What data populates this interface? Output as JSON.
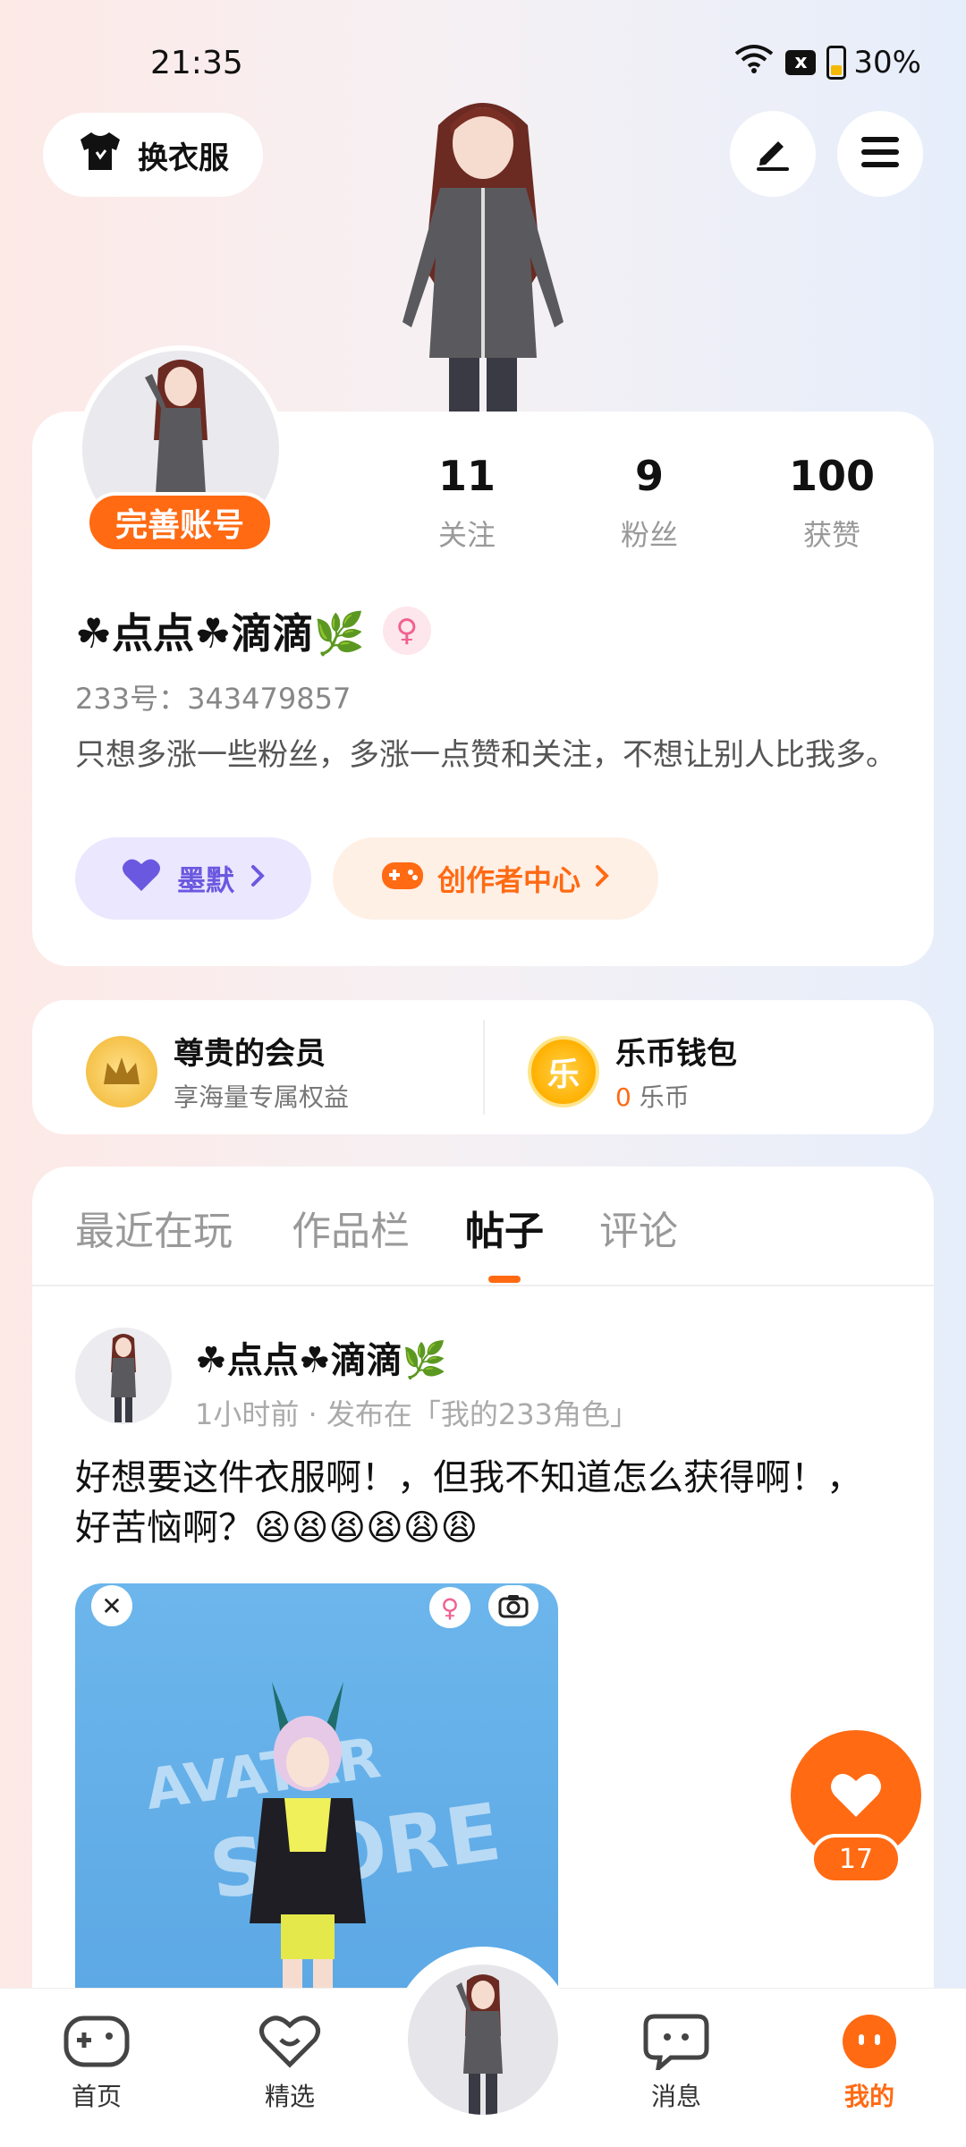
{
  "status_bar": {
    "time": "21:35",
    "battery": "30%",
    "sim_icon": "x"
  },
  "header": {
    "outfit_label": "换衣服"
  },
  "profile": {
    "complete_label": "完善账号",
    "stats": [
      {
        "value": "11",
        "label": "关注"
      },
      {
        "value": "9",
        "label": "粉丝"
      },
      {
        "value": "100",
        "label": "获赞"
      }
    ],
    "nickname": "☘点点☘滴滴🌿",
    "uid": "233号：343479857",
    "bio": "只想多涨一些粉丝，多涨一点赞和关注，不想让别人比我多。",
    "pill_mo": "墨默",
    "pill_creator": "创作者中心"
  },
  "vip": {
    "title": "尊贵的会员",
    "subtitle": "享海量专属权益"
  },
  "wallet": {
    "title": "乐币钱包",
    "coin_glyph": "乐",
    "amount": "0",
    "unit": "乐币"
  },
  "tabs": [
    {
      "label": "最近在玩"
    },
    {
      "label": "作品栏"
    },
    {
      "label": "帖子"
    },
    {
      "label": "评论"
    }
  ],
  "post": {
    "author": "☘点点☘滴滴🌿",
    "meta": "1小时前 · 发布在「我的233角色」",
    "text": "好想要这件衣服啊！，但我不知道怎么获得啊！，好苦恼啊？😫😫😫😫😩😩",
    "image_text_1": "AVATAR",
    "image_text_2": "STORE"
  },
  "like_count": "17",
  "bottom_nav": [
    {
      "label": "首页"
    },
    {
      "label": "精选"
    },
    {
      "label": "消息"
    },
    {
      "label": "我的"
    }
  ],
  "colors": {
    "accent": "#ff6a13",
    "purple": "#6b58e0"
  }
}
